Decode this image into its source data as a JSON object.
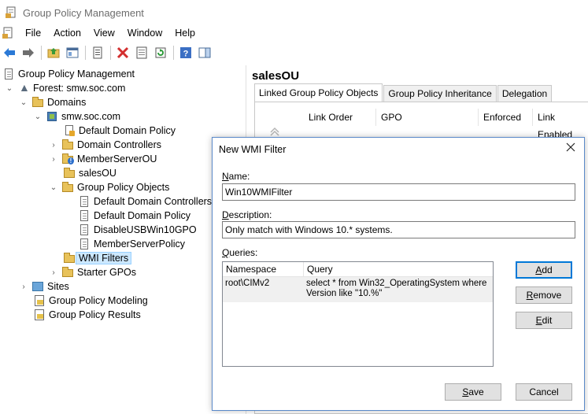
{
  "window": {
    "title": "Group Policy Management"
  },
  "menubar": {
    "items": [
      "File",
      "Action",
      "View",
      "Window",
      "Help"
    ]
  },
  "toolbar": {
    "buttons": [
      "back-icon",
      "forward-icon",
      "up-folder-icon",
      "show-hide-tree-icon",
      "properties-icon",
      "delete-icon",
      "export-list-icon",
      "refresh-icon",
      "help-icon",
      "action-pane-icon"
    ]
  },
  "tree": {
    "items": [
      {
        "label": "Group Policy Management"
      },
      {
        "label": "Forest: smw.soc.com"
      },
      {
        "label": "Domains"
      },
      {
        "label": "smw.soc.com"
      },
      {
        "label": "Default Domain Policy"
      },
      {
        "label": "Domain Controllers"
      },
      {
        "label": "MemberServerOU"
      },
      {
        "label": "salesOU"
      },
      {
        "label": "Group Policy Objects"
      },
      {
        "label": "Default Domain Controllers P"
      },
      {
        "label": "Default Domain Policy"
      },
      {
        "label": "DisableUSBWin10GPO"
      },
      {
        "label": "MemberServerPolicy"
      },
      {
        "label": "WMI Filters"
      },
      {
        "label": "Starter GPOs"
      },
      {
        "label": "Sites"
      },
      {
        "label": "Group Policy Modeling"
      },
      {
        "label": "Group Policy Results"
      }
    ]
  },
  "right_pane": {
    "title": "salesOU",
    "tabs": [
      "Linked Group Policy Objects",
      "Group Policy Inheritance",
      "Delegation"
    ],
    "columns": [
      "Link Order",
      "GPO",
      "Enforced",
      "Link Enabled"
    ]
  },
  "dialog": {
    "title": "New WMI Filter",
    "name_label_key": "N",
    "name_label_rest": "ame:",
    "name_value": "Win10WMIFilter",
    "description_label_key": "D",
    "description_label_rest": "escription:",
    "description_value": "Only match with Windows 10.* systems.",
    "queries_label_key": "Q",
    "queries_label_rest": "ueries:",
    "queries_columns": [
      "Namespace",
      "Query"
    ],
    "queries_rows": [
      {
        "namespace": "root\\CIMv2",
        "query_line1": "select * from Win32_OperatingSystem where",
        "query_line2": "Version like \"10.%\""
      }
    ],
    "add_key": "A",
    "add_rest": "dd",
    "remove_key": "R",
    "remove_rest": "emove",
    "edit_key": "E",
    "edit_rest": "dit",
    "save_key": "S",
    "save_rest": "ave",
    "cancel_label": "Cancel"
  },
  "colors": {
    "selection": "#cce8ff",
    "dialog_border": "#5a89c9",
    "default_button_border": "#0078d7"
  }
}
